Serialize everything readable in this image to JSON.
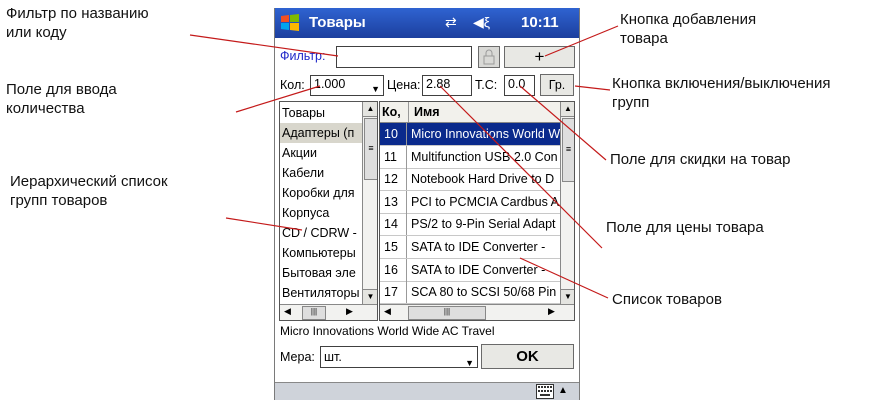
{
  "annotations": {
    "filter": [
      "Фильтр по названию",
      "или коду"
    ],
    "quantity": [
      "Поле для ввода",
      "количества"
    ],
    "groups_list": [
      "Иерархический список",
      "групп товаров"
    ],
    "add_button": [
      "Кнопка добавления",
      "товара"
    ],
    "groups_toggle": [
      "Кнопка включения/выключения",
      "групп"
    ],
    "discount": "Поле для скидки на товар",
    "price": "Поле для цены товара",
    "items_list": "Список товаров"
  },
  "app": {
    "title": "Товары",
    "time": "10:11",
    "filter_label": "Фильтр:",
    "filter_value": "",
    "add_label": "+",
    "qty_label": "Кол:",
    "qty_value": "1.000",
    "price_label": "Цена:",
    "price_value": "2.88",
    "discount_label": "Т.С:",
    "discount_value": "0.0",
    "groups_button": "Гр.",
    "selected_item": "Micro Innovations World Wide AC Travel",
    "unit_label": "Мера:",
    "unit_value": "шт.",
    "ok_label": "OK"
  },
  "groups": [
    "Товары",
    "Адаптеры (п",
    "Акции",
    "Кабели",
    "Коробки для",
    "Корпуса",
    "CD / CDRW -",
    "Компьютеры",
    "Бытовая эле",
    "Вентиляторы"
  ],
  "items_header": {
    "code": "Ко,",
    "name": "Имя"
  },
  "items": [
    {
      "code": "10",
      "name": "Micro Innovations World Wide"
    },
    {
      "code": "11",
      "name": "Multifunction USB 2.0 Con"
    },
    {
      "code": "12",
      "name": "Notebook Hard Drive to D"
    },
    {
      "code": "13",
      "name": "PCI to PCMCIA Cardbus A"
    },
    {
      "code": "14",
      "name": "PS/2 to 9-Pin Serial Adapt"
    },
    {
      "code": "15",
      "name": "SATA to IDE Converter -"
    },
    {
      "code": "16",
      "name": "SATA to IDE Converter -"
    },
    {
      "code": "17",
      "name": "SCA 80 to SCSI 50/68 Pin"
    }
  ],
  "colors": {
    "titlebar": "#2f63d1",
    "selection": "#0a2a8c",
    "label_blue": "#1f27c8"
  }
}
